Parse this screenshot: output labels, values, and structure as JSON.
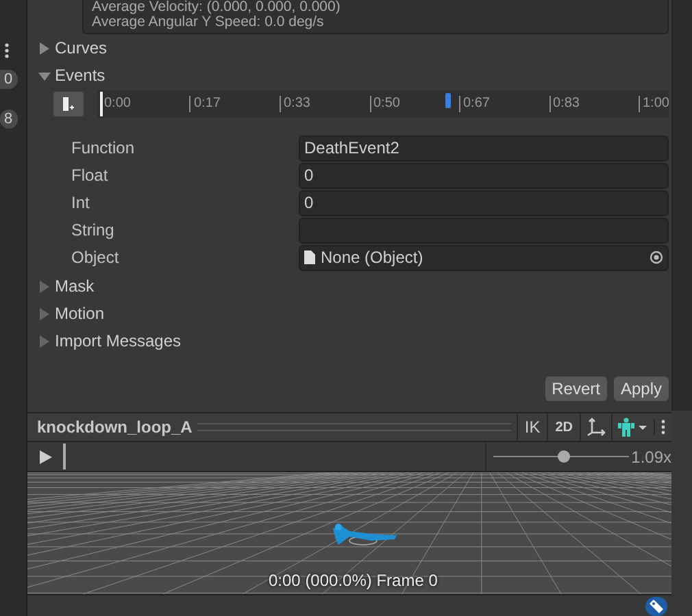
{
  "side_strip": {
    "badges": [
      "0",
      "8"
    ]
  },
  "info_box": {
    "lines": [
      "Average Velocity: (0.000, 0.000, 0.000)",
      "Average Angular Y Speed: 0.0 deg/s"
    ]
  },
  "sections_top": [
    {
      "label": "Curves",
      "expanded": false
    },
    {
      "label": "Events",
      "expanded": true
    }
  ],
  "events": {
    "ticks": [
      "0:00",
      "0:17",
      "0:33",
      "0:50",
      "0:67",
      "0:83",
      "1:00"
    ],
    "playhead": {
      "level": 0
    },
    "markers": [
      {
        "level": 0.64,
        "selected": true
      }
    ]
  },
  "fields": [
    {
      "kind": "text",
      "label": "Function",
      "value": "DeathEvent2"
    },
    {
      "kind": "text",
      "label": "Float",
      "value": "0"
    },
    {
      "kind": "text",
      "label": "Int",
      "value": "0"
    },
    {
      "kind": "text",
      "label": "String"
    },
    {
      "kind": "object",
      "label": "Object",
      "value": "None (Object)"
    }
  ],
  "sections_bottom": [
    {
      "label": "Mask",
      "expanded": false
    },
    {
      "label": "Motion",
      "expanded": false
    },
    {
      "label": "Import Messages",
      "expanded": false
    }
  ],
  "buttons": [
    "Revert",
    "Apply"
  ],
  "preview": {
    "title": "knockdown_loop_A",
    "toolbar": [
      "IK",
      "2D"
    ],
    "scrubber": {
      "level": 0
    },
    "speed": {
      "level": 0.52,
      "reading": "1.09x"
    },
    "caption": "0:00 (000.0%) Frame 0"
  }
}
